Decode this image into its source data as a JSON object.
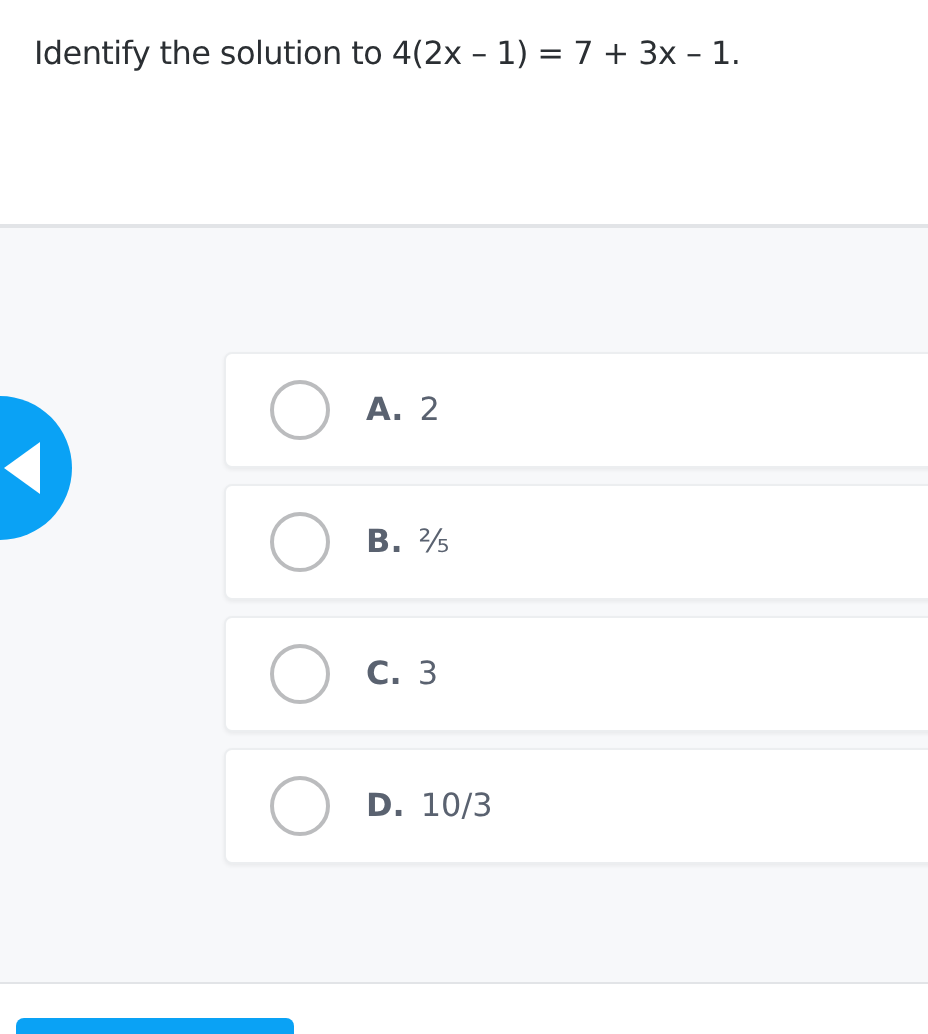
{
  "question": "Identify the solution to 4(2x – 1) = 7 + 3x – 1.",
  "options": [
    {
      "letter": "A.",
      "text": "2",
      "selected": false
    },
    {
      "letter": "B.",
      "text": "⅖",
      "selected": false
    },
    {
      "letter": "C.",
      "text": "3",
      "selected": false
    },
    {
      "letter": "D.",
      "text": "10/3",
      "selected": false
    }
  ]
}
